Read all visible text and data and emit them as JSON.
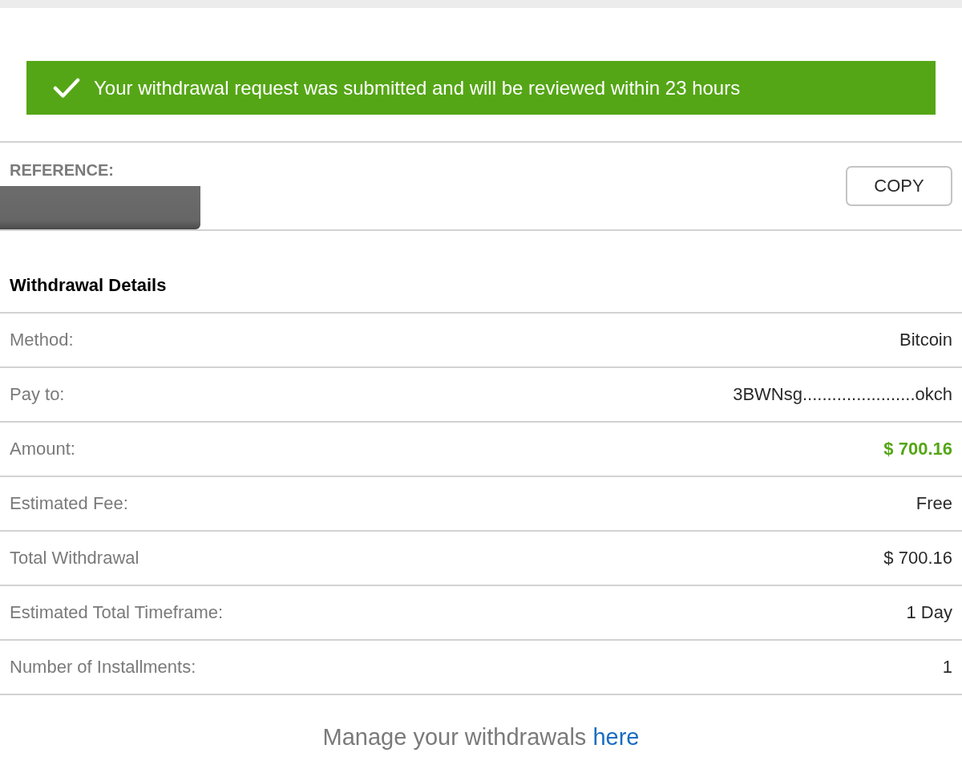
{
  "banner": {
    "kind": "success",
    "message": "Your withdrawal request was submitted and will be reviewed within 23 hours"
  },
  "reference": {
    "label": "REFERENCE:",
    "redacted": true,
    "copy_button": "COPY"
  },
  "details": {
    "title": "Withdrawal Details",
    "rows": [
      {
        "label": "Method:",
        "value": "Bitcoin",
        "emphasis": false
      },
      {
        "label": "Pay to:",
        "value": "3BWNsg.......................okch",
        "emphasis": false
      },
      {
        "label": "Amount:",
        "value": "$ 700.16",
        "emphasis": true
      },
      {
        "label": "Estimated Fee:",
        "value": "Free",
        "emphasis": false
      },
      {
        "label": "Total Withdrawal",
        "value": "$ 700.16",
        "emphasis": false
      },
      {
        "label": "Estimated Total Timeframe:",
        "value": "1 Day",
        "emphasis": false
      },
      {
        "label": "Number of Installments:",
        "value": "1",
        "emphasis": false
      }
    ]
  },
  "footer": {
    "text": "Manage your withdrawals",
    "link": "here"
  }
}
